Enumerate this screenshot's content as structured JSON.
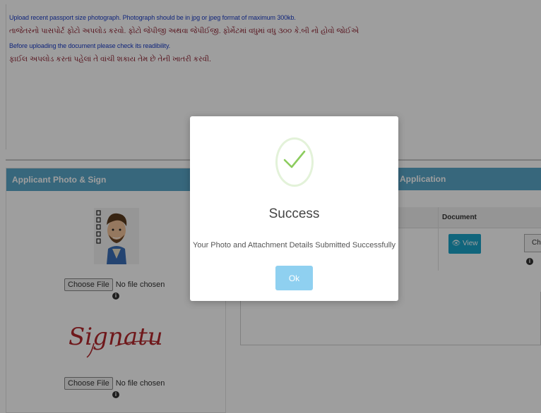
{
  "notes": {
    "line1": "Upload recent passport size photograph. Photograph should be in jpg or jpeg format of maximum 300kb.",
    "line2": "તાજેતરનો પાસપોર્ટ ફોટો અપલોડ કરવો. ફોટો જેપીજી અથવા જેપીઈજી. ફોર્મેટમાં વધુમાં વધુ ૩૦૦ કે.બી નો હોવો જોઈએ",
    "line3": "Before uploading the document please check its readibility.",
    "line4": "ફાઈલ અપલોડ કરતાં પહેલાં તે વાંચી શકાય તેમ છે તેની ખાતરી કરવી."
  },
  "left_panel": {
    "title": "Applicant Photo & Sign",
    "photo_file": {
      "button": "Choose File",
      "status": "No file chosen"
    },
    "sign_file": {
      "button": "Choose File",
      "status": "No file chosen"
    },
    "signature_text": "Signature"
  },
  "right_panel": {
    "title": "Application",
    "table_header": "Document",
    "view_label": "View",
    "choose_label": "Choose"
  },
  "modal": {
    "title": "Success",
    "message": "Your Photo and Attachment Details Submitted Successfully",
    "ok_label": "Ok",
    "check_color": "#8ccc5e"
  },
  "colors": {
    "panel_header": "#5aa6c9",
    "view_button": "#1ba3c9",
    "ok_button": "#8fd0f0"
  }
}
